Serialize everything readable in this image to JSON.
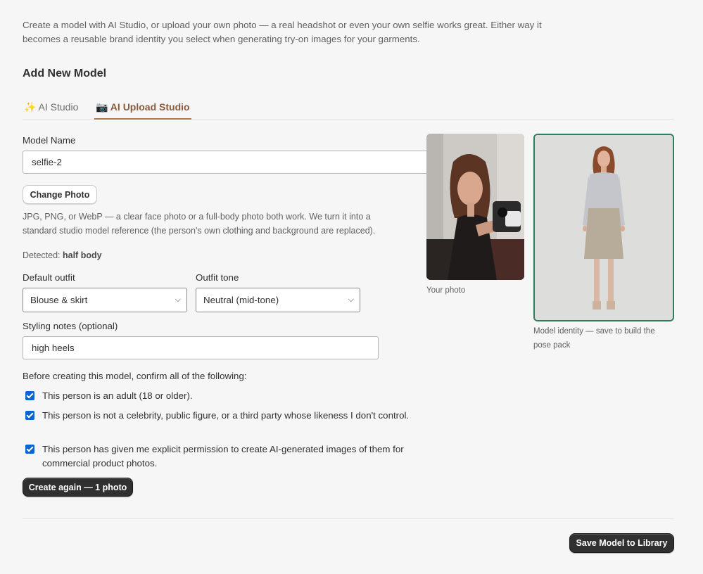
{
  "intro": "Create a model with AI Studio, or upload your own photo — a real headshot or even your own selfie works great. Either way it becomes a reusable brand identity you select when generating try-on images for your garments.",
  "section_title": "Add New Model",
  "tabs": [
    {
      "label": "✨ AI Studio",
      "active": false
    },
    {
      "label": "📷 AI Upload Studio",
      "active": true
    }
  ],
  "form": {
    "model_name_label": "Model Name",
    "model_name_value": "selfie-2",
    "change_photo_label": "Change Photo",
    "help_text": "JPG, PNG, or WebP — a clear face photo or a full-body photo both work. We turn it into a standard studio model reference (the person's own clothing and background are replaced).",
    "detected_label": "Detected:",
    "detected_value": "half body",
    "default_outfit_label": "Default outfit",
    "default_outfit_value": "Blouse & skirt",
    "outfit_tone_label": "Outfit tone",
    "outfit_tone_value": "Neutral (mid-tone)",
    "styling_notes_label": "Styling notes (optional)",
    "styling_notes_value": "high heels",
    "confirm_title": "Before creating this model, confirm all of the following:",
    "confirmations": [
      {
        "text": "This person is an adult (18 or older).",
        "checked": true
      },
      {
        "text": "This person is not a celebrity, public figure, or a third party whose likeness I don't control.",
        "checked": true
      },
      {
        "text": "This person has given me explicit permission to create AI-generated images of them for commercial product photos.",
        "checked": true
      }
    ],
    "create_button": "Create again — 1 photo"
  },
  "previews": {
    "your_photo_caption": "Your photo",
    "model_identity_caption": "Model identity — save to build the pose pack",
    "accent_border": "#2e7d5b"
  },
  "footer": {
    "save_button": "Save Model to Library"
  }
}
